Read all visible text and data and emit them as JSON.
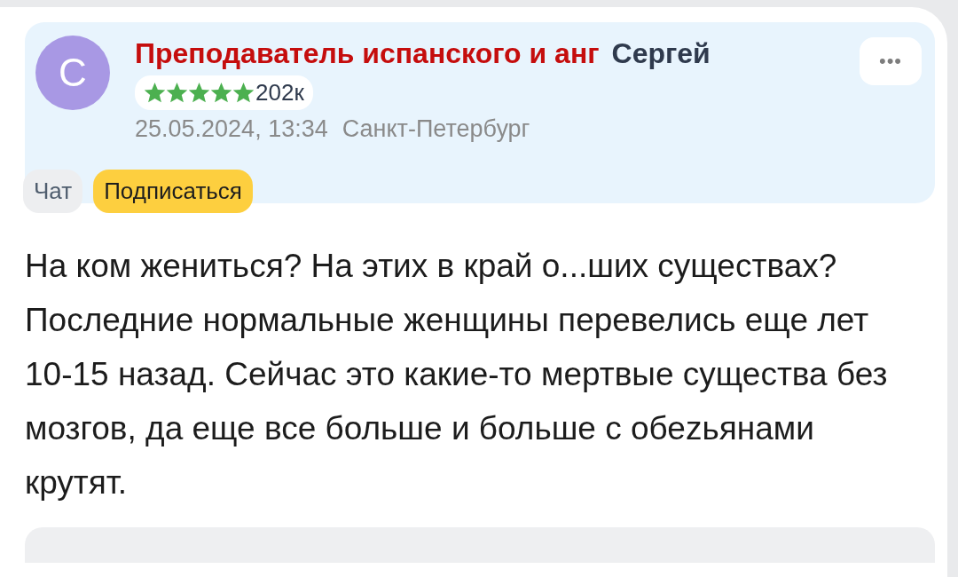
{
  "post": {
    "author": {
      "avatar_letter": "С",
      "title": "Преподаватель испанского и анг",
      "name": "Сергей",
      "stars": 5,
      "rating_count": "202к",
      "date": "25.05.2024, 13:34",
      "location": "Санкт-Петербург",
      "more": "•••"
    },
    "actions": [
      {
        "kind": "chat",
        "label": "Чат"
      },
      {
        "kind": "subscribe",
        "label": "Подписаться"
      }
    ],
    "text": "На ком жениться? На этих в край о...ших существах? Последние нормальные женщины перевелись еще лет 10-15 назад. Сейчас это какие-то мертвые существа без мозгов, да еще все больше и больше с обеzьянами крутят."
  }
}
